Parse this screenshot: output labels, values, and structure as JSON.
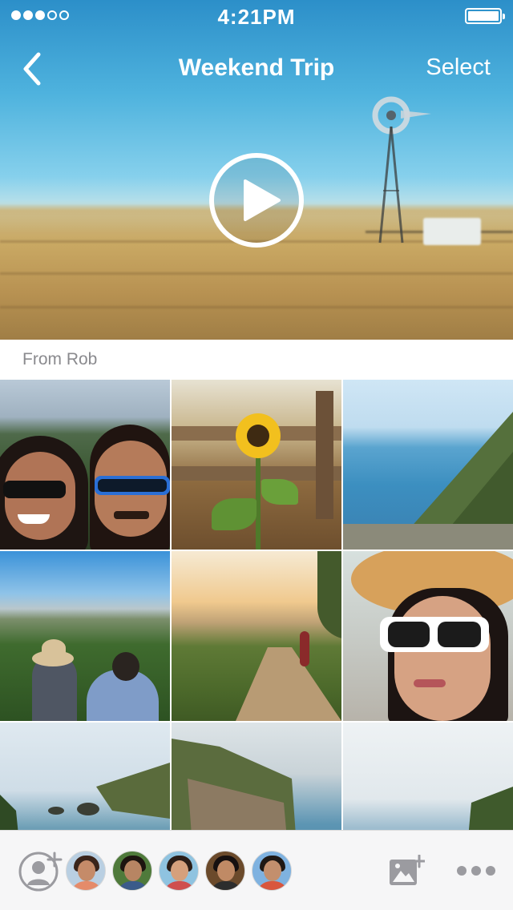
{
  "status_bar": {
    "time": "4:21PM",
    "signal_strength": 3,
    "signal_max": 5
  },
  "nav": {
    "title": "Weekend Trip",
    "select_label": "Select",
    "back_icon": "chevron-left-icon"
  },
  "hero": {
    "play_icon": "play-icon"
  },
  "section": {
    "label": "From Rob"
  },
  "grid": {
    "photos": [
      "selfie-couple-sunglasses",
      "sunflower-by-fence",
      "coastal-cliffs-ocean",
      "couple-overlooking-city",
      "person-on-trail-sunset",
      "woman-straw-hat-sunglasses",
      "coastline-rocks",
      "bixby-coast-cliffs",
      "ocean-horizon"
    ]
  },
  "bottom_bar": {
    "add_person_icon": "add-person-icon",
    "add_photo_icon": "add-photo-icon",
    "more_icon": "more-icon",
    "avatars": [
      "avatar-1",
      "avatar-2",
      "avatar-3",
      "avatar-4",
      "avatar-5"
    ]
  },
  "colors": {
    "accent_white": "#ffffff",
    "label_gray": "#8a8a8e",
    "icon_gray": "#9b9ba0",
    "bottom_bar_bg": "#f6f6f7"
  }
}
